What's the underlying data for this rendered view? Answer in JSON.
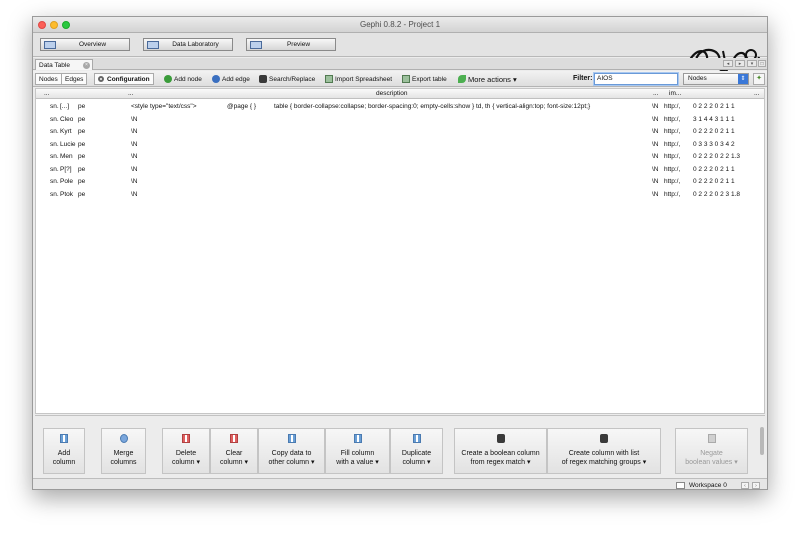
{
  "window": {
    "title": "Gephi 0.8.2 - Project 1"
  },
  "modes": [
    {
      "label": "Overview"
    },
    {
      "label": "Data Laboratory"
    },
    {
      "label": "Preview"
    }
  ],
  "panel": {
    "tab_label": "Data Table",
    "tab_close": "×"
  },
  "toolbar": {
    "nodes_label": "Nodes",
    "edges_label": "Edges",
    "configuration_label": "Configuration",
    "add_node_label": "Add node",
    "add_edge_label": "Add edge",
    "search_replace_label": "Search/Replace",
    "import_spreadsheet_label": "Import Spreadsheet",
    "export_table_label": "Export table",
    "more_actions_label": "More actions",
    "more_actions_arrow": "▾"
  },
  "filter": {
    "label": "Filter:",
    "value": "AIOS",
    "column_selected": "Nodes",
    "select_arrow": "⇕",
    "wand": "✦"
  },
  "table": {
    "headers": {
      "left": "...",
      "left2": "...",
      "description": "description",
      "ellipsis": "...",
      "im": "im...",
      "right": "..."
    },
    "rows": [
      {
        "id": "sn.",
        "label": "[...]",
        "type": "pe",
        "desc": "<style type=\"text/css\">",
        "desc2": "@page {   }",
        "desc3": "table { border-collapse:collapse; border-spacing:0; empty-cells:show }  td, th { vertical-align:top; font-size:12pt;}",
        "mark": "\\N",
        "url": "http:/,",
        "nums": "0  2  2  2  0  2  1  1"
      },
      {
        "id": "sn.",
        "label": "Cleo",
        "type": "pe",
        "desc": "\\N",
        "desc2": "",
        "desc3": "",
        "mark": "\\N",
        "url": "http:/,",
        "nums": "3  1  4  4  3  1  1  1"
      },
      {
        "id": "sn.",
        "label": "Kyrt",
        "type": "pe",
        "desc": "\\N",
        "desc2": "",
        "desc3": "",
        "mark": "\\N",
        "url": "http:/,",
        "nums": "0  2  2  2  0  2  1  1"
      },
      {
        "id": "sn.",
        "label": "Lucie",
        "type": "pe",
        "desc": "\\N",
        "desc2": "",
        "desc3": "",
        "mark": "\\N",
        "url": "http:/,",
        "nums": "0  3  3  3  0  3  4  2"
      },
      {
        "id": "sn.",
        "label": "Men",
        "type": "pe",
        "desc": "\\N",
        "desc2": "",
        "desc3": "",
        "mark": "\\N",
        "url": "http:/,",
        "nums": "0  2  2  2  0  2  2  1.3"
      },
      {
        "id": "sn.",
        "label": "P[?]",
        "type": "pe",
        "desc": "\\N",
        "desc2": "",
        "desc3": "",
        "mark": "\\N",
        "url": "http:/,",
        "nums": "0  2  2  2  0  2  1  1"
      },
      {
        "id": "sn.",
        "label": "Pole",
        "type": "pe",
        "desc": "\\N",
        "desc2": "",
        "desc3": "",
        "mark": "\\N",
        "url": "http:/,",
        "nums": "0  2  2  2  0  2  1  1"
      },
      {
        "id": "sn.",
        "label": "Ptok",
        "type": "pe",
        "desc": "\\N",
        "desc2": "",
        "desc3": "",
        "mark": "\\N",
        "url": "http:/,",
        "nums": "0  2  2  2  0  2  3  1.8"
      }
    ]
  },
  "actions": [
    {
      "name": "add-column-button",
      "line1": "Add",
      "line2": "column",
      "icon": "column-icon",
      "enabled": true
    },
    {
      "name": "merge-columns-button",
      "line1": "Merge",
      "line2": "columns",
      "icon": "merge-icon",
      "enabled": true
    },
    {
      "name": "delete-column-button",
      "line1": "Delete",
      "line2": "column ▾",
      "icon": "delete-column-icon",
      "enabled": true
    },
    {
      "name": "clear-column-button",
      "line1": "Clear",
      "line2": "column ▾",
      "icon": "clear-column-icon",
      "enabled": true
    },
    {
      "name": "copy-data-button",
      "line1": "Copy data to",
      "line2": "other column ▾",
      "icon": "copy-column-icon",
      "enabled": true
    },
    {
      "name": "fill-column-button",
      "line1": "Fill column",
      "line2": "with a value ▾",
      "icon": "fill-column-icon",
      "enabled": true
    },
    {
      "name": "duplicate-column-button",
      "line1": "Duplicate",
      "line2": "column ▾",
      "icon": "duplicate-column-icon",
      "enabled": true
    },
    {
      "name": "boolean-regex-button",
      "line1": "Create a boolean column",
      "line2": "from regex match ▾",
      "icon": "binoculars-icon",
      "enabled": true
    },
    {
      "name": "regex-list-button",
      "line1": "Create column with list",
      "line2": "of regex matching groups ▾",
      "icon": "binoculars-icon",
      "enabled": true
    },
    {
      "name": "negate-boolean-button",
      "line1": "Negate",
      "line2": "boolean values ▾",
      "icon": "negate-icon",
      "enabled": false
    }
  ],
  "status": {
    "workspace": "Workspace 0",
    "prev": "‹",
    "next": "›"
  },
  "colors": {
    "accent": "#3a78d8",
    "close": "#fc5f57",
    "minimize": "#fdbc2e",
    "maximize": "#2ac840"
  }
}
